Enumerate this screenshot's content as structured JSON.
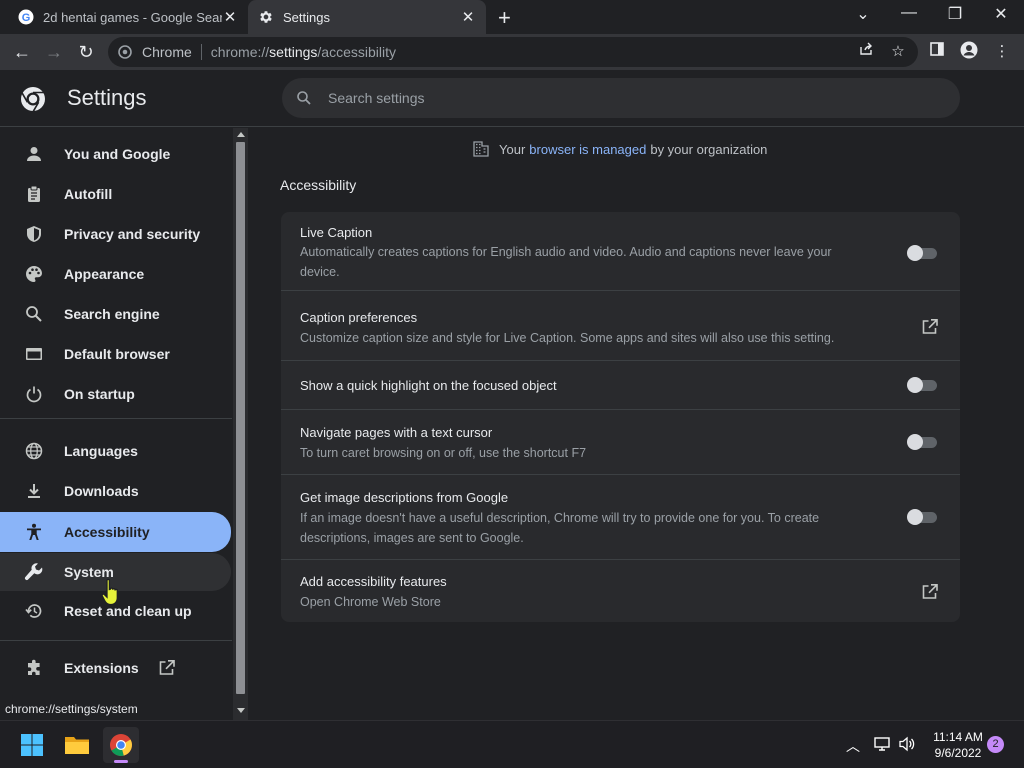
{
  "browser": {
    "tabs": [
      {
        "title": "2d hentai games - Google Search",
        "active": false
      },
      {
        "title": "Settings",
        "active": true
      }
    ],
    "omnibox": {
      "scheme_label": "Chrome",
      "url_prefix": "chrome://",
      "url_host": "settings",
      "url_path": "/accessibility"
    }
  },
  "settings": {
    "title": "Settings",
    "search_placeholder": "Search settings",
    "managed_notice": {
      "prefix": "Your",
      "link": "browser is managed",
      "suffix": "by your organization"
    },
    "sidebar": {
      "items": [
        {
          "label": "You and Google",
          "icon": "person-icon"
        },
        {
          "label": "Autofill",
          "icon": "clipboard-icon"
        },
        {
          "label": "Privacy and security",
          "icon": "shield-icon"
        },
        {
          "label": "Appearance",
          "icon": "palette-icon"
        },
        {
          "label": "Search engine",
          "icon": "search-icon"
        },
        {
          "label": "Default browser",
          "icon": "browser-window-icon"
        },
        {
          "label": "On startup",
          "icon": "power-icon"
        },
        {
          "label": "Languages",
          "icon": "globe-icon"
        },
        {
          "label": "Downloads",
          "icon": "download-icon"
        },
        {
          "label": "Accessibility",
          "icon": "accessibility-icon",
          "selected": true
        },
        {
          "label": "System",
          "icon": "wrench-icon",
          "hovered": true
        },
        {
          "label": "Reset and clean up",
          "icon": "restore-icon"
        },
        {
          "label": "Extensions",
          "icon": "puzzle-icon"
        }
      ]
    },
    "section_title": "Accessibility",
    "rows": [
      {
        "label": "Live Caption",
        "sub": "Automatically creates captions for English audio and video. Audio and captions never leave your device.",
        "control": "toggle",
        "on": false
      },
      {
        "label": "Caption preferences",
        "sub": "Customize caption size and style for Live Caption. Some apps and sites will also use this setting.",
        "control": "external-link"
      },
      {
        "label": "Show a quick highlight on the focused object",
        "sub": "",
        "control": "toggle",
        "on": false
      },
      {
        "label": "Navigate pages with a text cursor",
        "sub": "To turn caret browsing on or off, use the shortcut F7",
        "control": "toggle",
        "on": false
      },
      {
        "label": "Get image descriptions from Google",
        "sub": "If an image doesn't have a useful description, Chrome will try to provide one for you. To create descriptions, images are sent to Google.",
        "control": "toggle",
        "on": false
      },
      {
        "label": "Add accessibility features",
        "sub": "Open Chrome Web Store",
        "control": "external-link"
      }
    ]
  },
  "status_bar": {
    "url": "chrome://settings/system"
  },
  "taskbar": {
    "time": "11:14 AM",
    "date": "9/6/2022",
    "notification_count": "2"
  },
  "colors": {
    "accent": "#8ab4f8",
    "background": "#202124",
    "card": "#292a2d"
  }
}
